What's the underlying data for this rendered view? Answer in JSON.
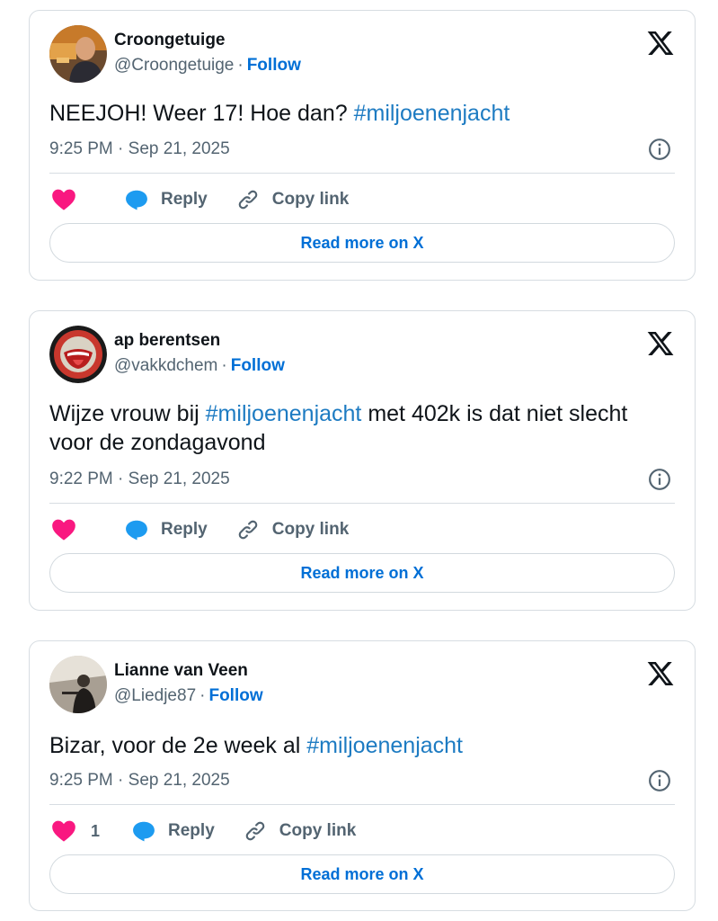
{
  "tweets": [
    {
      "display_name": "Croongetuige",
      "handle": "@Croongetuige",
      "separator": "·",
      "follow_label": "Follow",
      "text_before": "NEEJOH! Weer 17! Hoe dan? ",
      "hashtag": "#miljoenenjacht",
      "text_after": "",
      "timestamp": "9:25 PM · Sep 21, 2025",
      "like_count": "",
      "reply_label": "Reply",
      "copy_label": "Copy link",
      "read_more_label": "Read more on X"
    },
    {
      "display_name": "ap berentsen",
      "handle": "@vakkdchem",
      "separator": "·",
      "follow_label": "Follow",
      "text_before": "Wijze vrouw bij ",
      "hashtag": "#miljoenenjacht",
      "text_after": " met 402k is dat niet slecht voor de zondagavond",
      "timestamp": "9:22 PM · Sep 21, 2025",
      "like_count": "",
      "reply_label": "Reply",
      "copy_label": "Copy link",
      "read_more_label": "Read more on X"
    },
    {
      "display_name": "Lianne van Veen",
      "handle": "@Liedje87",
      "separator": "·",
      "follow_label": "Follow",
      "text_before": "Bizar, voor de 2e week al ",
      "hashtag": "#miljoenenjacht",
      "text_after": "",
      "timestamp": "9:25 PM · Sep 21, 2025",
      "like_count": "1",
      "reply_label": "Reply",
      "copy_label": "Copy link",
      "read_more_label": "Read more on X"
    }
  ],
  "icons": {
    "logo": "x-logo-icon",
    "info": "info-icon",
    "like": "heart-icon",
    "reply": "speech-bubble-icon",
    "copy": "link-icon"
  },
  "colors": {
    "accent": "#006fd6",
    "hashtag": "#1d7bc2",
    "heart": "#f91880",
    "reply_bubble": "#1d9bf0",
    "muted": "#536471",
    "border": "#d7dde2"
  }
}
